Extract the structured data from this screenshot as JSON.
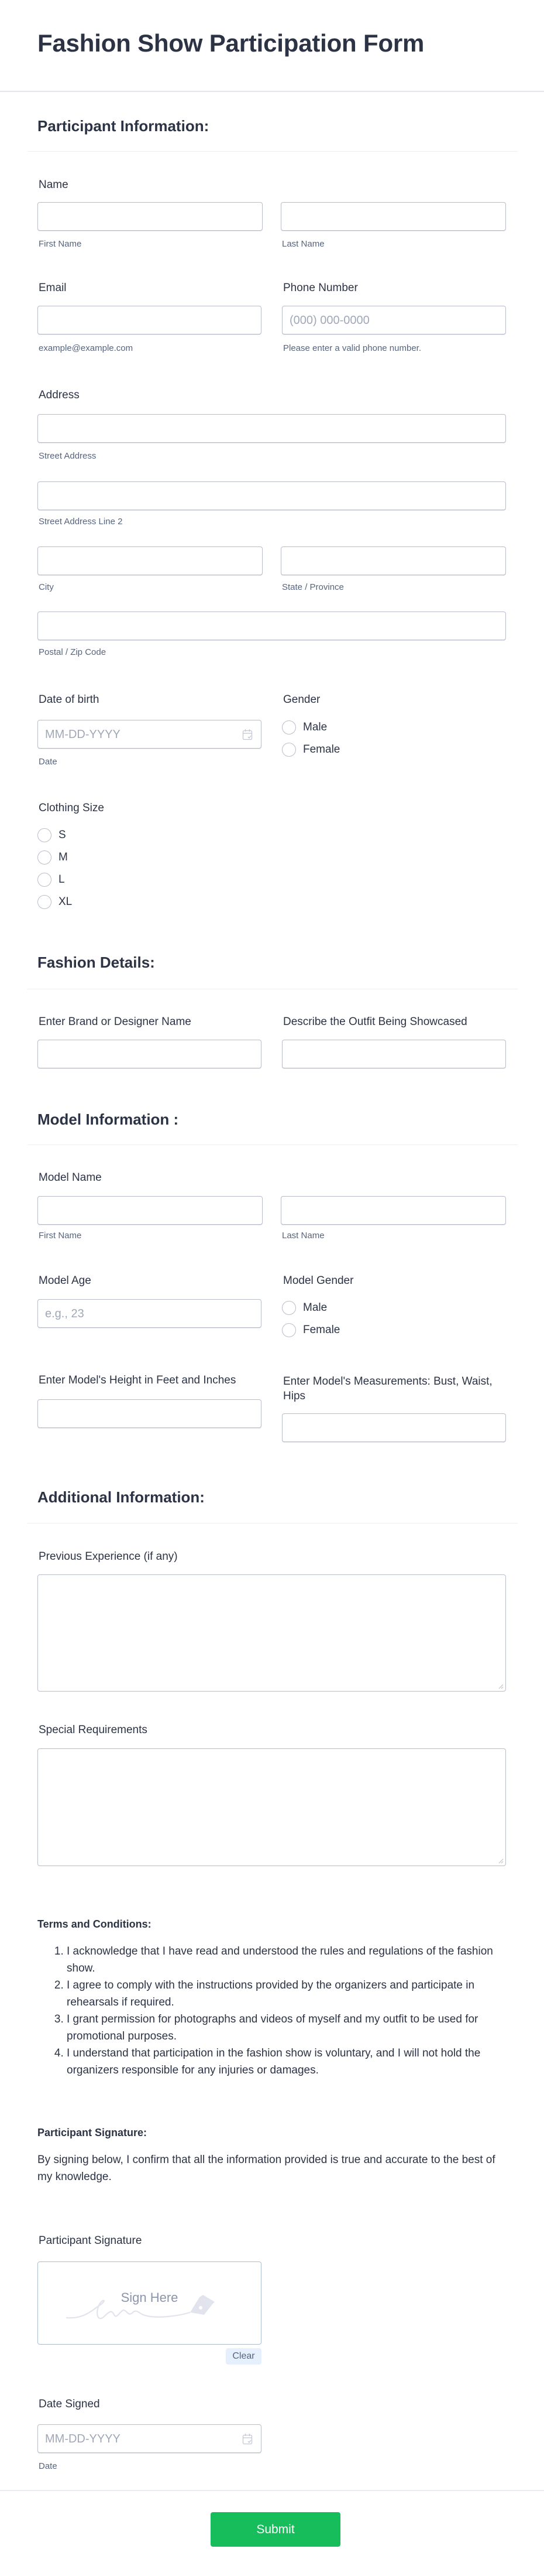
{
  "form": {
    "title": "Fashion Show Participation Form"
  },
  "sections": {
    "participant": {
      "title": "Participant Information:",
      "name": {
        "label": "Name",
        "first_sublabel": "First Name",
        "last_sublabel": "Last Name"
      },
      "email": {
        "label": "Email",
        "sublabel": "example@example.com"
      },
      "phone": {
        "label": "Phone Number",
        "placeholder": "(000) 000-0000",
        "sublabel": "Please enter a valid phone number."
      },
      "address": {
        "label": "Address",
        "street_sublabel": "Street Address",
        "street2_sublabel": "Street Address Line 2",
        "city_sublabel": "City",
        "state_sublabel": "State / Province",
        "zip_sublabel": "Postal / Zip Code"
      },
      "dob": {
        "label": "Date of birth",
        "placeholder": "MM-DD-YYYY",
        "sublabel": "Date"
      },
      "gender": {
        "label": "Gender",
        "options": [
          "Male",
          "Female"
        ]
      },
      "clothing_size": {
        "label": "Clothing Size",
        "options": [
          "S",
          "M",
          "L",
          "XL"
        ]
      }
    },
    "fashion": {
      "title": "Fashion Details:",
      "brand_label": "Enter Brand or Designer Name",
      "outfit_label": "Describe the Outfit Being Showcased"
    },
    "model": {
      "title": "Model Information :",
      "name": {
        "label": "Model Name",
        "first_sublabel": "First Name",
        "last_sublabel": "Last Name"
      },
      "age": {
        "label": "Model Age",
        "placeholder": "e.g., 23"
      },
      "gender": {
        "label": "Model Gender",
        "options": [
          "Male",
          "Female"
        ]
      },
      "height_label": "Enter Model's Height in Feet and Inches",
      "measurements_label": "Enter Model's Measurements: Bust, Waist, Hips"
    },
    "additional": {
      "title": "Additional Information:",
      "experience_label": "Previous Experience (if any)",
      "requirements_label": "Special Requirements"
    },
    "terms": {
      "title": "Terms and Conditions:",
      "items": [
        "I acknowledge that I have read and understood the rules and regulations of the fashion show.",
        "I agree to comply with the instructions provided by the organizers and participate in rehearsals if required.",
        "I grant permission for photographs and videos of myself and my outfit to be used for promotional purposes.",
        "I understand that participation in the fashion show is voluntary, and I will not hold the organizers responsible for any injuries or damages."
      ]
    },
    "signature": {
      "title": "Participant Signature:",
      "statement": "By signing below, I confirm that all the information provided is true and accurate to the best of my knowledge.",
      "field_label": "Participant Signature",
      "pad_text": "Sign Here",
      "clear_label": "Clear",
      "date_label": "Date Signed",
      "date_placeholder": "MM-DD-YYYY",
      "date_sublabel": "Date"
    }
  },
  "submit_label": "Submit",
  "colors": {
    "accent": "#18bd5b",
    "text": "#2c3345",
    "sublabel": "#57647e",
    "border": "#b8bdc9"
  }
}
